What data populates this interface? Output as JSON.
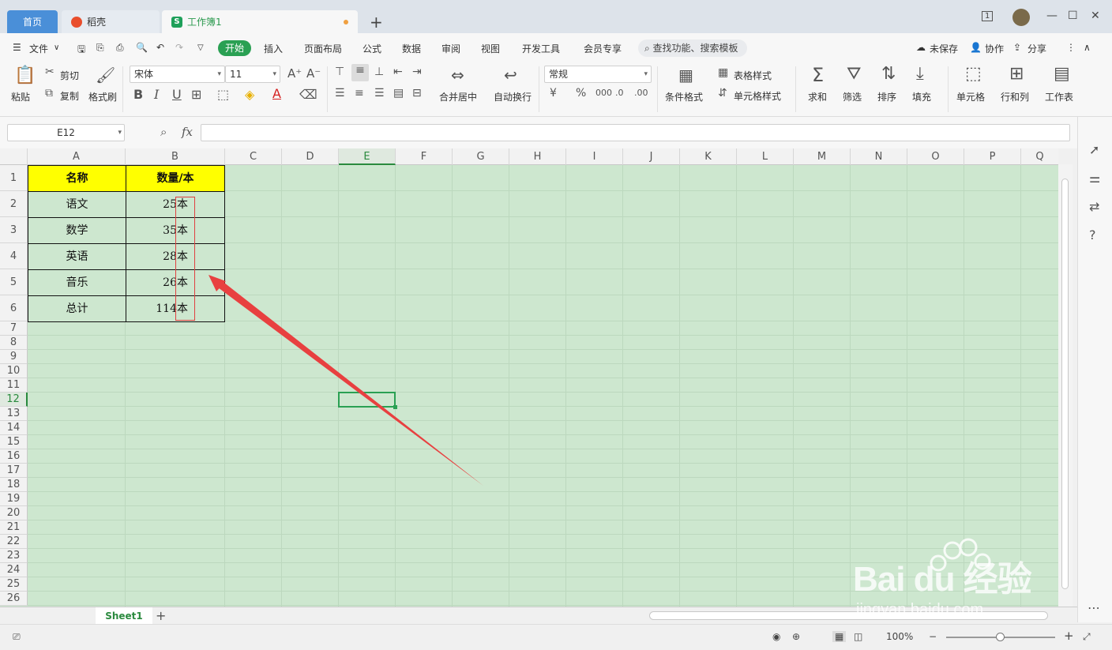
{
  "tabs": {
    "home": "首页",
    "daoke": "稻壳",
    "workbook": "工作簿1",
    "new": "+"
  },
  "window": {
    "page_count": "1"
  },
  "menu": {
    "file": "文件",
    "items": [
      "开始",
      "插入",
      "页面布局",
      "公式",
      "数据",
      "审阅",
      "视图",
      "开发工具",
      "会员专享"
    ],
    "search": "查找功能、搜索模板",
    "unsaved": "未保存",
    "collab": "协作",
    "share": "分享"
  },
  "ribbon": {
    "paste": "粘贴",
    "cut": "剪切",
    "copy": "复制",
    "format_painter": "格式刷",
    "font_name": "宋体",
    "font_size": "11",
    "merge_center": "合并居中",
    "wrap": "自动换行",
    "number_format": "常规",
    "cond_format": "条件格式",
    "table_style": "表格样式",
    "cell_style": "单元格样式",
    "sum": "求和",
    "filter": "筛选",
    "sort": "排序",
    "fill": "填充",
    "cell": "单元格",
    "rowcol": "行和列",
    "sheet": "工作表"
  },
  "formula": {
    "name_box": "E12",
    "fx": "fx",
    "content": ""
  },
  "columns": [
    "A",
    "B",
    "C",
    "D",
    "E",
    "F",
    "G",
    "H",
    "I",
    "J",
    "K",
    "L",
    "M",
    "N",
    "O",
    "P",
    "Q"
  ],
  "rows": [
    "1",
    "2",
    "3",
    "4",
    "5",
    "6",
    "7",
    "8",
    "9",
    "10",
    "11",
    "12",
    "13",
    "14",
    "15",
    "16",
    "17",
    "18",
    "19",
    "20",
    "21",
    "22",
    "23",
    "24",
    "25",
    "26"
  ],
  "table": {
    "header": [
      "名称",
      "数量/本"
    ],
    "rows": [
      [
        "语文",
        "25本"
      ],
      [
        "数学",
        "35本"
      ],
      [
        "英语",
        "28本"
      ],
      [
        "音乐",
        "26本"
      ],
      [
        "总计",
        "114本"
      ]
    ]
  },
  "sheets": [
    "Sheet1"
  ],
  "status": {
    "zoom": "100%"
  },
  "watermark": {
    "brand": "Bai du 经验",
    "url": "jingyan.baidu.com"
  },
  "colors": {
    "accent": "#2aa053",
    "grid_bg": "#cde7cf",
    "header_fill": "#ffff00",
    "annotation": "#e04040"
  }
}
